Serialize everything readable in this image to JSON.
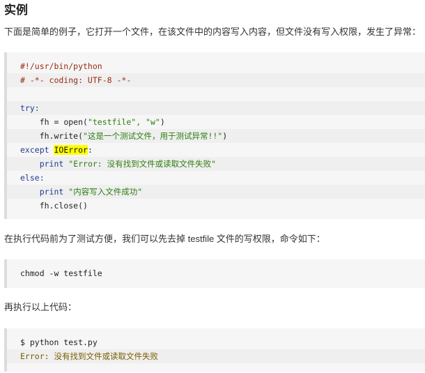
{
  "title": "实例",
  "intro": "下面是简单的例子，它打开一个文件，在该文件中的内容写入内容，但文件没有写入权限，发生了异常：",
  "code1": {
    "shebang": "#!/usr/bin/python",
    "coding": "# -*- coding: UTF-8 -*-",
    "try_kw": "try:",
    "fh_open_prefix": "fh = open(",
    "fh_open_args": "\"testfile\", \"w\"",
    "fh_open_suffix": ")",
    "write_prefix": "fh.write(",
    "write_arg": "\"这是一个测试文件，用于测试异常!!\"",
    "write_suffix": ")",
    "except_kw": "except",
    "except_name": "IOError",
    "except_colon": ":",
    "print1_kw": "print",
    "print1_str": "\"Error: 没有找到文件或读取文件失败\"",
    "else_kw": "else:",
    "print2_kw": "print",
    "print2_str": "\"内容写入文件成功\"",
    "close": "fh.close()"
  },
  "mid_text": "在执行代码前为了测试方便，我们可以先去掉 testfile 文件的写权限，命令如下：",
  "code2": {
    "cmd": "chmod -w testfile"
  },
  "rerun_text": "再执行以上代码：",
  "code3": {
    "cmd": "$ python test.py",
    "error_label": "Error:",
    "error_msg": " 没有找到文件或读取文件失败"
  }
}
